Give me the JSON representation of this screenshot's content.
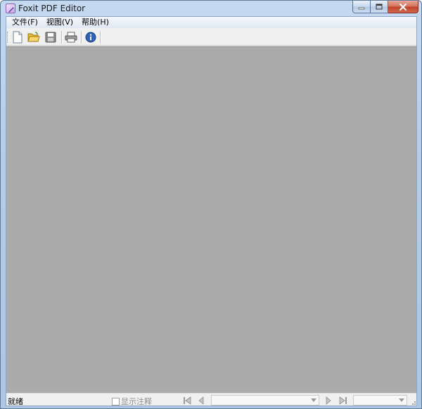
{
  "window": {
    "title": "Foxit PDF Editor",
    "caption_buttons": [
      "minimize",
      "maximize",
      "close"
    ]
  },
  "menu": {
    "items": [
      {
        "label": "文件(F)"
      },
      {
        "label": "视图(V)"
      },
      {
        "label": "帮助(H)"
      }
    ]
  },
  "toolbar": {
    "buttons": [
      {
        "icon": "new-document-icon"
      },
      {
        "icon": "open-folder-icon"
      },
      {
        "icon": "save-disk-icon"
      },
      {
        "icon": "printer-icon"
      },
      {
        "icon": "about-info-icon"
      }
    ]
  },
  "statusbar": {
    "status_text": "就绪",
    "show_annotations_label": "显示注释",
    "show_annotations_checked": false,
    "page_value": "",
    "zoom_value": ""
  },
  "colors": {
    "canvas": "#ababab",
    "chrome": "#f0f0f0",
    "title_gradient": "#c4d9f0",
    "close_button": "#c2432a"
  }
}
